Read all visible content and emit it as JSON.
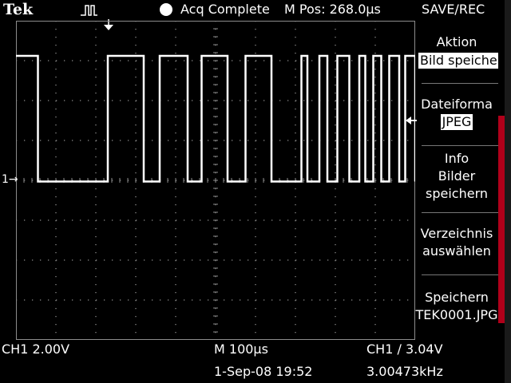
{
  "header": {
    "brand": "Tek",
    "acquisition_status": "Acq Complete",
    "main_position": "M Pos: 268.0µs",
    "menu_title": "SAVE/REC"
  },
  "menu": {
    "action_label": "Aktion",
    "action_value": "Bild speicher",
    "format_label": "Dateiforma",
    "format_value": "JPEG",
    "info_line1": "Info",
    "info_line2": "Bilder",
    "info_line3": "speichern",
    "folder_line1": "Verzeichnis",
    "folder_line2": "auswählen",
    "save_line1": "Speichern",
    "save_line2": "TEK0001.JPG"
  },
  "channel_marker": "1→",
  "status": {
    "ch1_scale": "CH1  2.00V",
    "timebase": "M 100µs",
    "trigger": "CH1 ∕ 3.04V",
    "date_time": "1-Sep-08 19:52",
    "frequency": "3.00473kHz"
  },
  "waveform": {
    "high_level_div": 3.1,
    "low_level_div": -0.05,
    "transitions_div": [
      0.55,
      2.3,
      3.2,
      3.6,
      4.3,
      4.65,
      5.3,
      5.75,
      6.4,
      7.15,
      7.3,
      7.6,
      7.8,
      8.05,
      8.35,
      8.6,
      8.75,
      8.95,
      9.15,
      9.35,
      9.6,
      9.75,
      10.0
    ]
  },
  "colors": {
    "trace": "#ffffff",
    "grid": "#8c8c8c",
    "accent": "#b0001a"
  }
}
